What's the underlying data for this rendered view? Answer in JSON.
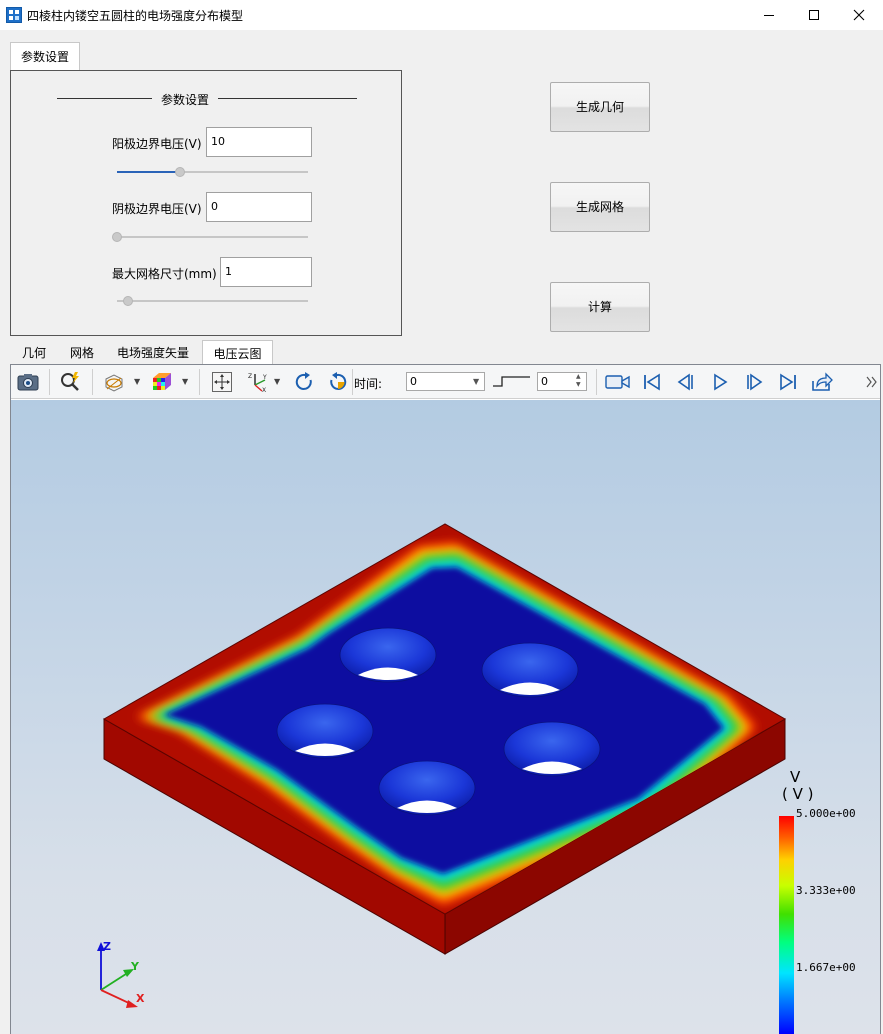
{
  "window": {
    "title": "四棱柱内镂空五圆柱的电场强度分布模型"
  },
  "param_tab": {
    "label": "参数设置"
  },
  "params": {
    "group_title": "参数设置",
    "anode": {
      "label": "阳极边界电压(V)",
      "value": "10",
      "slider_fraction": 0.33
    },
    "cathode": {
      "label": "阴极边界电压(V)",
      "value": "0",
      "slider_fraction": 0.0
    },
    "mesh": {
      "label": "最大网格尺寸(mm)",
      "value": "1",
      "slider_fraction": 0.03
    }
  },
  "buttons": {
    "geometry": "生成几何",
    "mesh": "生成网格",
    "compute": "计算"
  },
  "view_tabs": [
    "几何",
    "网格",
    "电场强度矢量",
    "电压云图"
  ],
  "view_tabs_active": 3,
  "toolbar": {
    "icons": [
      "camera-icon",
      "zoom-icon",
      "display-style-icon",
      "colormap-icon",
      "fit-view-icon",
      "axes-orientation-icon",
      "rotate-cw-icon",
      "rotate-ccw-icon",
      "record-icon",
      "first-frame-icon",
      "prev-frame-icon",
      "play-icon",
      "next-frame-icon",
      "last-frame-icon",
      "export-icon"
    ],
    "time_label": "时间:",
    "time_value": "0",
    "step_value": "0"
  },
  "legend": {
    "title": "V",
    "unit": "( V )",
    "max": "5.000e+00",
    "mid_high": "3.333e+00",
    "mid_low": "1.667e+00"
  },
  "axes": {
    "x": "X",
    "y": "Y",
    "z": "Z"
  },
  "colors": {
    "plate_red": "#b10d00",
    "plate_side": "#950800",
    "field_blue": "#0a0e96",
    "green": "#3cc23c"
  }
}
